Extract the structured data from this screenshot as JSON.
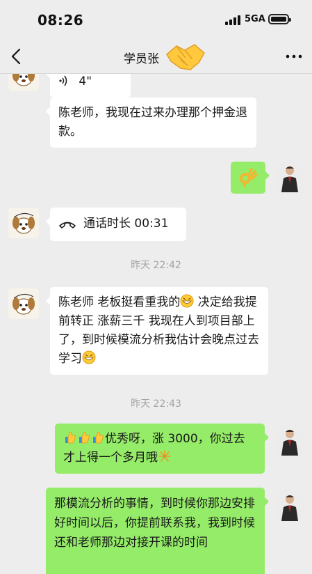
{
  "status_bar": {
    "time": "08:26",
    "network": "5GA"
  },
  "nav": {
    "title": "学员张"
  },
  "messages": [
    {
      "id": "voice",
      "type": "voice",
      "side": "left",
      "duration": "4\""
    },
    {
      "id": "m1",
      "side": "left",
      "text": "陈老师，我现在过来办理那个押金退款。"
    },
    {
      "id": "m2",
      "side": "right",
      "type": "emoji-ok"
    },
    {
      "id": "call",
      "side": "left",
      "type": "call",
      "text": "通话时长 00:31"
    },
    {
      "id": "t1",
      "type": "time",
      "text": "昨天 22:42"
    },
    {
      "id": "m3",
      "side": "left",
      "text_a": "陈老师 老板挺看重我的",
      "text_b": " 决定给我提前转正 涨薪三千  我现在人到项目部上了，到时候模流分析我估计会晚点过去学习"
    },
    {
      "id": "t2",
      "type": "time",
      "text": "昨天 22:43"
    },
    {
      "id": "m4",
      "side": "right",
      "text": "优秀呀，涨 3000，你过去才上得一个多月哦"
    },
    {
      "id": "m5",
      "side": "right",
      "text": "那模流分析的事情，到时候你那边安排好时间以后，你提前联系我，我到时候还和老师那边对接开课的时间"
    }
  ],
  "colors": {
    "bg": "#ededed",
    "bubble_in": "#ffffff",
    "bubble_out": "#95ec69",
    "time": "#a3a3a3"
  }
}
